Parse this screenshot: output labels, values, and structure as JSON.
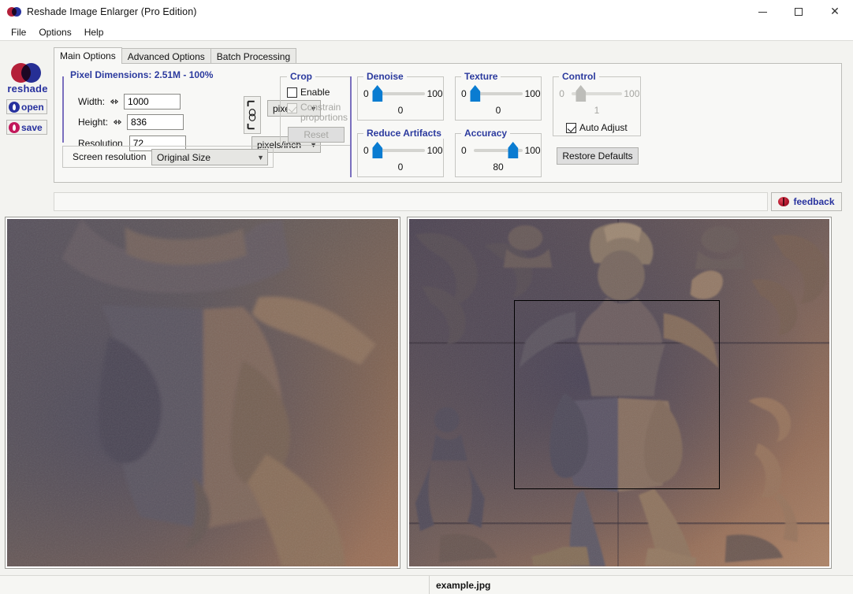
{
  "window": {
    "title": "Reshade Image Enlarger (Pro Edition)",
    "logo_red": "#b4203a",
    "logo_blue": "#27319e",
    "minimize": "–",
    "maximize": "□",
    "close": "×"
  },
  "menu": {
    "items": [
      {
        "label": "File"
      },
      {
        "label": "Options"
      },
      {
        "label": "Help"
      }
    ]
  },
  "rail": {
    "brand": "reshade",
    "open_label": "open",
    "save_label": "save"
  },
  "tabs": [
    {
      "label": "Main Options",
      "active": true
    },
    {
      "label": "Advanced Options",
      "active": false
    },
    {
      "label": "Batch Processing",
      "active": false
    }
  ],
  "pixel_dimensions": {
    "legend": "Pixel Dimensions:  2.51M - 100%",
    "size_mp": "2.51M",
    "scale_pct": "100%",
    "width_label": "Width:",
    "width_value": "1000",
    "height_label": "Height:",
    "height_value": "836",
    "resolution_label": "Resolution",
    "resolution_value": "72",
    "unit_selected": "pixels",
    "resolution_unit_selected": "pixels/inch",
    "screen_resolution_label": "Screen resolution",
    "screen_resolution_selected": "Original Size"
  },
  "crop": {
    "legend": "Crop",
    "enable_label": "Enable",
    "enable_checked": false,
    "constrain_label_line1": "Constrain",
    "constrain_label_line2": "proportions",
    "constrain_checked": true,
    "constrain_disabled": true,
    "reset_label": "Reset",
    "reset_disabled": true
  },
  "sliders": [
    {
      "name": "denoise",
      "legend": "Denoise",
      "min": "0",
      "max": "100",
      "value": "0",
      "pct": 0,
      "disabled": false
    },
    {
      "name": "reduce",
      "legend": "Reduce Artifacts",
      "min": "0",
      "max": "100",
      "value": "0",
      "pct": 0,
      "disabled": false
    },
    {
      "name": "texture",
      "legend": "Texture",
      "min": "0",
      "max": "100",
      "value": "0",
      "pct": 0,
      "disabled": false
    },
    {
      "name": "accuracy",
      "legend": "Accuracy",
      "min": "0",
      "max": "100",
      "value": "80",
      "pct": 80,
      "disabled": false
    },
    {
      "name": "control",
      "legend": "Control",
      "min": "0",
      "max": "100",
      "value": "1",
      "pct": 1,
      "disabled": true
    }
  ],
  "control": {
    "auto_adjust_label": "Auto Adjust",
    "auto_adjust_checked": true,
    "restore_defaults_label": "Restore Defaults"
  },
  "feedback": {
    "label": "feedback"
  },
  "infobar": {
    "text": ""
  },
  "status": {
    "filename": "example.jpg"
  },
  "preview": {
    "left_panel_name": "zoomed-detail-preview",
    "right_panel_name": "full-image-preview",
    "selection_visible": true
  },
  "colors": {
    "accent_blue": "#2b3a9e",
    "slider_blue": "#0a7cd1",
    "purple_bar": "#7a6fbe",
    "window_bg": "#f3f3f0"
  }
}
